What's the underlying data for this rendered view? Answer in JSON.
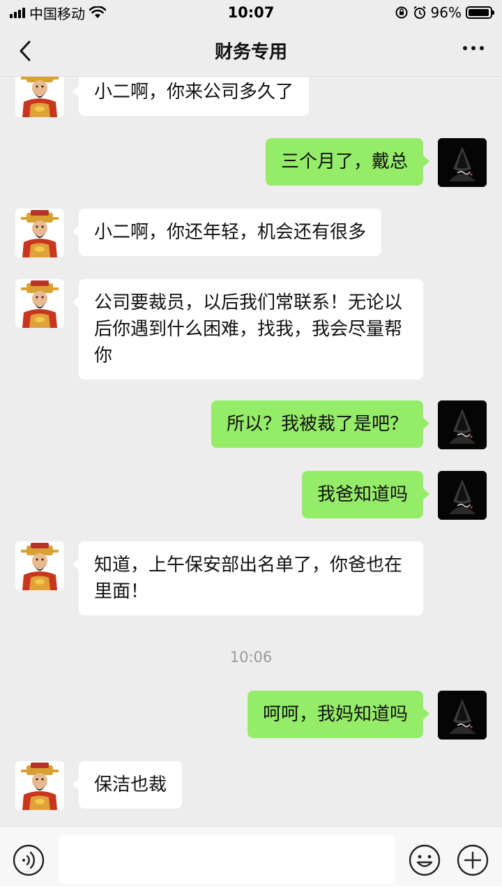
{
  "status_bar": {
    "carrier": "中国移动",
    "time": "10:07",
    "battery": "96%",
    "battery_level": 0.96
  },
  "header": {
    "title": "财务专用"
  },
  "messages": [
    {
      "side": "left",
      "text": "小二啊，你来公司多久了"
    },
    {
      "side": "right",
      "text": "三个月了，戴总"
    },
    {
      "side": "left",
      "text": "小二啊，你还年轻，机会还有很多"
    },
    {
      "side": "left",
      "text": "公司要裁员，以后我们常联系！无论以后你遇到什么困难，找我，我会尽量帮你"
    },
    {
      "side": "right",
      "text": "所以？我被裁了是吧？"
    },
    {
      "side": "right",
      "text": "我爸知道吗"
    },
    {
      "side": "left",
      "text": "知道，上午保安部出名单了，你爸也在里面！"
    },
    {
      "side": "right",
      "text": "呵呵，我妈知道吗"
    },
    {
      "side": "left",
      "text": "保洁也裁"
    }
  ],
  "timestamp": "10:06",
  "input": {
    "value": "",
    "placeholder": ""
  },
  "icons": {
    "back": "chevron-left-icon",
    "more": "more-dots-icon",
    "voice": "voice-icon",
    "emoji": "emoji-icon",
    "plus": "plus-icon"
  },
  "colors": {
    "background": "#ededed",
    "sent_bubble": "#95ec69",
    "received_bubble": "#ffffff",
    "timestamp": "#999999"
  }
}
